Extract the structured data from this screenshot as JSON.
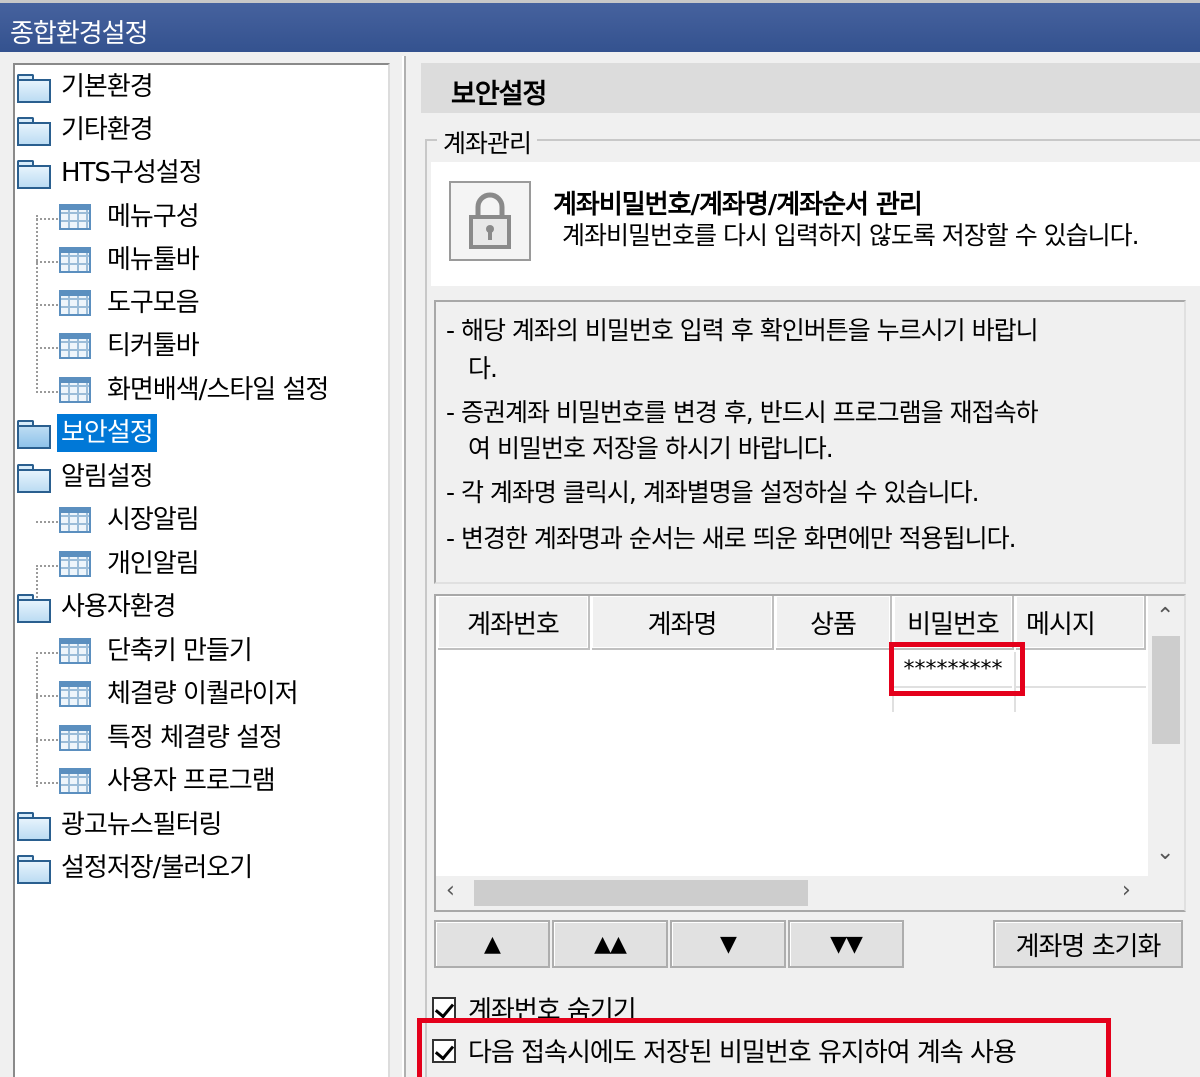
{
  "window": {
    "title": "종합환경설정"
  },
  "tree": {
    "items": [
      {
        "label": "기본환경",
        "icon": "folder-icon"
      },
      {
        "label": "기타환경",
        "icon": "folder-icon"
      },
      {
        "label": "HTS구성설정",
        "icon": "folder-icon"
      },
      {
        "label": "메뉴구성",
        "icon": "grid-icon"
      },
      {
        "label": "메뉴툴바",
        "icon": "grid-icon"
      },
      {
        "label": "도구모음",
        "icon": "grid-icon"
      },
      {
        "label": "티커툴바",
        "icon": "grid-icon"
      },
      {
        "label": "화면배색/스타일 설정",
        "icon": "grid-icon"
      },
      {
        "label": "보안설정",
        "icon": "folder-open-icon",
        "selected": true
      },
      {
        "label": "알림설정",
        "icon": "folder-icon"
      },
      {
        "label": "시장알림",
        "icon": "grid-icon"
      },
      {
        "label": "개인알림",
        "icon": "grid-icon"
      },
      {
        "label": "사용자환경",
        "icon": "folder-icon"
      },
      {
        "label": "단축키 만들기",
        "icon": "grid-icon"
      },
      {
        "label": "체결량 이퀄라이저",
        "icon": "grid-icon"
      },
      {
        "label": "특정 체결량 설정",
        "icon": "grid-icon"
      },
      {
        "label": "사용자 프로그램",
        "icon": "grid-icon"
      },
      {
        "label": "광고뉴스필터링",
        "icon": "folder-icon"
      },
      {
        "label": "설정저장/불러오기",
        "icon": "folder-icon"
      }
    ]
  },
  "panel": {
    "title": "보안설정",
    "group_title": "계좌관리",
    "info_title": "계좌비밀번호/계좌명/계좌순서 관리",
    "info_desc": "계좌비밀번호를 다시 입력하지 않도록 저장할 수 있습니다.",
    "notes": [
      "- 해당 계좌의 비밀번호 입력 후 확인버튼을 누르시기 바랍니",
      "다.",
      "- 증권계좌 비밀번호를 변경 후, 반드시 프로그램을 재접속하",
      "여 비밀번호 저장을 하시기 바랍니다.",
      "- 각 계좌명 클릭시, 계좌별명을 설정하실 수 있습니다.",
      "- 변경한 계좌명과 순서는 새로 띄운 화면에만 적용됩니다."
    ],
    "table": {
      "headers": [
        "계좌번호",
        "계좌명",
        "상품",
        "비밀번호",
        "메시지"
      ],
      "password_value": "*********"
    },
    "buttons": {
      "up": "▲",
      "top": "▲▲",
      "down": "▼",
      "bottom": "▼▼",
      "reset_name": "계좌명 초기화"
    },
    "checkboxes": {
      "hide_account": "계좌번호 숨기기",
      "keep_password": "다음 접속시에도 저장된 비밀번호 유지하여 계속 사용"
    }
  }
}
